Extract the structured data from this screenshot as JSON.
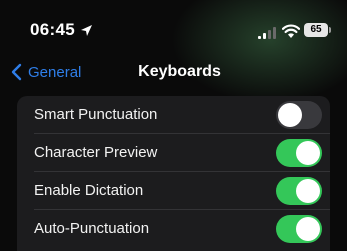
{
  "status_bar": {
    "time": "06:45",
    "battery": "65",
    "icons": [
      "location-arrow-icon",
      "signal-icon",
      "wifi-icon",
      "battery-icon"
    ]
  },
  "nav": {
    "back_label": "General",
    "title": "Keyboards",
    "accent_color": "#2f7ee8"
  },
  "settings": [
    {
      "label": "Smart Punctuation",
      "on": false
    },
    {
      "label": "Character Preview",
      "on": true
    },
    {
      "label": "Enable Dictation",
      "on": true
    },
    {
      "label": "Auto-Punctuation",
      "on": true
    }
  ],
  "colors": {
    "toggle_on": "#34c759",
    "toggle_off": "#39393d",
    "group_background": "#1c1c1e"
  }
}
